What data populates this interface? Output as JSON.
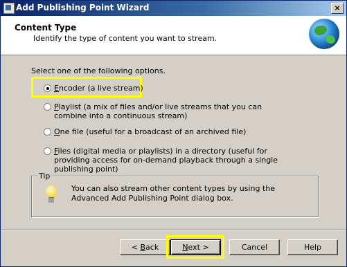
{
  "window": {
    "title": "Add Publishing Point Wizard",
    "close_glyph": "×"
  },
  "header": {
    "title": "Content Type",
    "subtitle": "Identify the type of content you want to stream."
  },
  "prompt": "Select one of the following options.",
  "options": [
    {
      "label_first": "E",
      "label_rest": "ncoder (a live stream)",
      "checked": true
    },
    {
      "label_first": "P",
      "label_rest": "laylist (a mix of files and/or live streams that you can combine into a continuous stream)",
      "checked": false
    },
    {
      "label_first": "O",
      "label_rest": "ne file (useful for a broadcast of an archived file)",
      "checked": false
    },
    {
      "label_first": "F",
      "label_rest": "iles (digital media or playlists) in a directory (useful for providing access for on-demand playback through a single publishing point)",
      "checked": false
    }
  ],
  "tip": {
    "legend": "Tip",
    "text": "You can also stream other content types by using the Advanced Add Publishing Point dialog box.",
    "icon": "lightbulb-icon"
  },
  "buttons": {
    "back_prefix": "< ",
    "back_first": "B",
    "back_rest": "ack",
    "next_first": "N",
    "next_rest": "ext >",
    "cancel": "Cancel",
    "help": "Help"
  },
  "highlight_color": "#ffff00"
}
